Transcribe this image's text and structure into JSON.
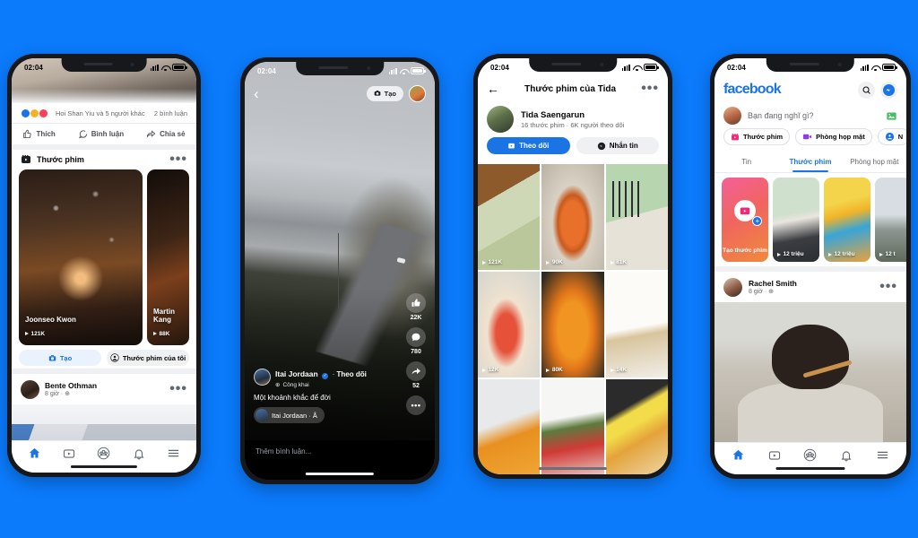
{
  "background_color": "#0b7bfc",
  "phones": {
    "phone1": {
      "name": "facebook-feed-reels-screen",
      "status": {
        "time": "02:04"
      },
      "post": {
        "reactions_text": "Hoi Shan Yiu và 5 người khác",
        "comments_count": "2 bình luận",
        "actions": [
          "Thích",
          "Bình luận",
          "Chia sẻ"
        ]
      },
      "reels_section": {
        "title": "Thước phim",
        "more": "•••",
        "cards": [
          {
            "name": "Joonseo Kwon",
            "views": "121K"
          },
          {
            "name": "Martin Kang",
            "views": "88K"
          }
        ],
        "buttons": [
          "Tạo",
          "Thước phim của tôi"
        ]
      },
      "next_post": {
        "author": "Bente Othman",
        "time": "8 giờ",
        "privacy": "Công khai"
      },
      "bottom_nav": [
        "home-icon",
        "watch-icon",
        "groups-icon",
        "notifications-icon",
        "menu-icon"
      ]
    },
    "phone2": {
      "name": "facebook-reels-player-screen",
      "status": {
        "time": "02:04"
      },
      "topbar": {
        "back": "‹",
        "create_label": "Tạo"
      },
      "author": {
        "name": "Itai Jordaan",
        "follow_label": "Theo dõi",
        "privacy": "Công khai"
      },
      "caption": "Một khoảnh khắc để đời",
      "music": {
        "label": "Itai Jordaan · Å"
      },
      "rail": {
        "likes": "22K",
        "comments": "780",
        "shares": "52",
        "more": "•••"
      },
      "comment_placeholder": "Thêm bình luận..."
    },
    "phone3": {
      "name": "facebook-reels-profile-screen",
      "status": {
        "time": "02:04"
      },
      "header": {
        "back": "←",
        "title": "Thước phim của Tida",
        "more": "•••"
      },
      "profile": {
        "name": "Tida Saengarun",
        "stats": "16 thước phim · 6K người theo dõi",
        "follow_label": "Theo dõi",
        "message_label": "Nhắn tin"
      },
      "grid": [
        {
          "views": "121K"
        },
        {
          "views": "90K"
        },
        {
          "views": "81K"
        },
        {
          "views": "12K"
        },
        {
          "views": "80K"
        },
        {
          "views": "14K"
        },
        {
          "views": ""
        },
        {
          "views": ""
        },
        {
          "views": ""
        }
      ]
    },
    "phone4": {
      "name": "facebook-home-feed-screen",
      "status": {
        "time": "02:04"
      },
      "header": {
        "logo": "facebook",
        "search_icon": "search-icon",
        "messenger_icon": "messenger-icon"
      },
      "composer": {
        "placeholder": "Bạn đang nghĩ gì?",
        "photo_icon": "photo-icon"
      },
      "pills": [
        "Thước phim",
        "Phòng họp mặt",
        "N"
      ],
      "tabs": [
        {
          "label": "Tin",
          "active": false
        },
        {
          "label": "Thước phim",
          "active": true
        },
        {
          "label": "Phòng họp mặt",
          "active": false
        }
      ],
      "reels_tray": [
        {
          "label": "Tạo thước phim",
          "views": ""
        },
        {
          "label": "",
          "views": "12 triệu"
        },
        {
          "label": "",
          "views": "12 triệu"
        },
        {
          "label": "",
          "views": "12 t"
        }
      ],
      "post": {
        "author": "Rachel Smith",
        "time": "8 giờ",
        "more": "•••"
      },
      "bottom_nav": [
        "home-icon",
        "watch-icon",
        "groups-icon",
        "notifications-icon",
        "menu-icon"
      ]
    }
  }
}
